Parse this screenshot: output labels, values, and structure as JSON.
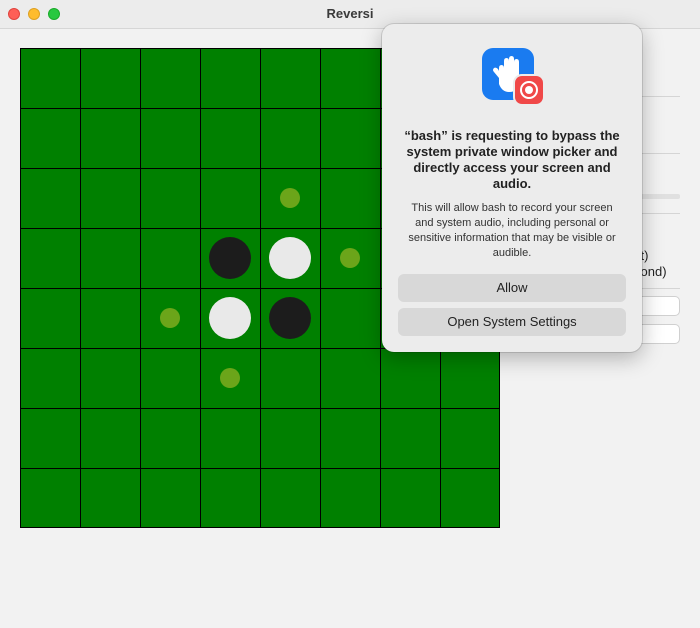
{
  "window": {
    "title": "Reversi"
  },
  "board": {
    "size": 8,
    "color": "#008000",
    "pieces": [
      {
        "row": 3,
        "col": 3,
        "color": "black"
      },
      {
        "row": 3,
        "col": 4,
        "color": "white"
      },
      {
        "row": 4,
        "col": 3,
        "color": "white"
      },
      {
        "row": 4,
        "col": 4,
        "color": "black"
      }
    ],
    "hints": [
      {
        "row": 2,
        "col": 4
      },
      {
        "row": 3,
        "col": 5
      },
      {
        "row": 4,
        "col": 2
      },
      {
        "row": 5,
        "col": 3
      }
    ],
    "hint_color": "#6ba51a"
  },
  "side_panel": {
    "partial_text_1": "st)",
    "partial_text_2": "cond)"
  },
  "dialog": {
    "icon": "hand-raised-icon",
    "badge_icon": "screen-record-icon",
    "heading": "“bash” is requesting to bypass the system private window picker and directly access your screen and audio.",
    "body": "This will allow bash to record your screen and system audio, including personal or sensitive information that may be visible or audible.",
    "allow_label": "Allow",
    "settings_label": "Open System Settings",
    "icon_color": "#1a7bf0",
    "badge_color": "#f04848"
  }
}
